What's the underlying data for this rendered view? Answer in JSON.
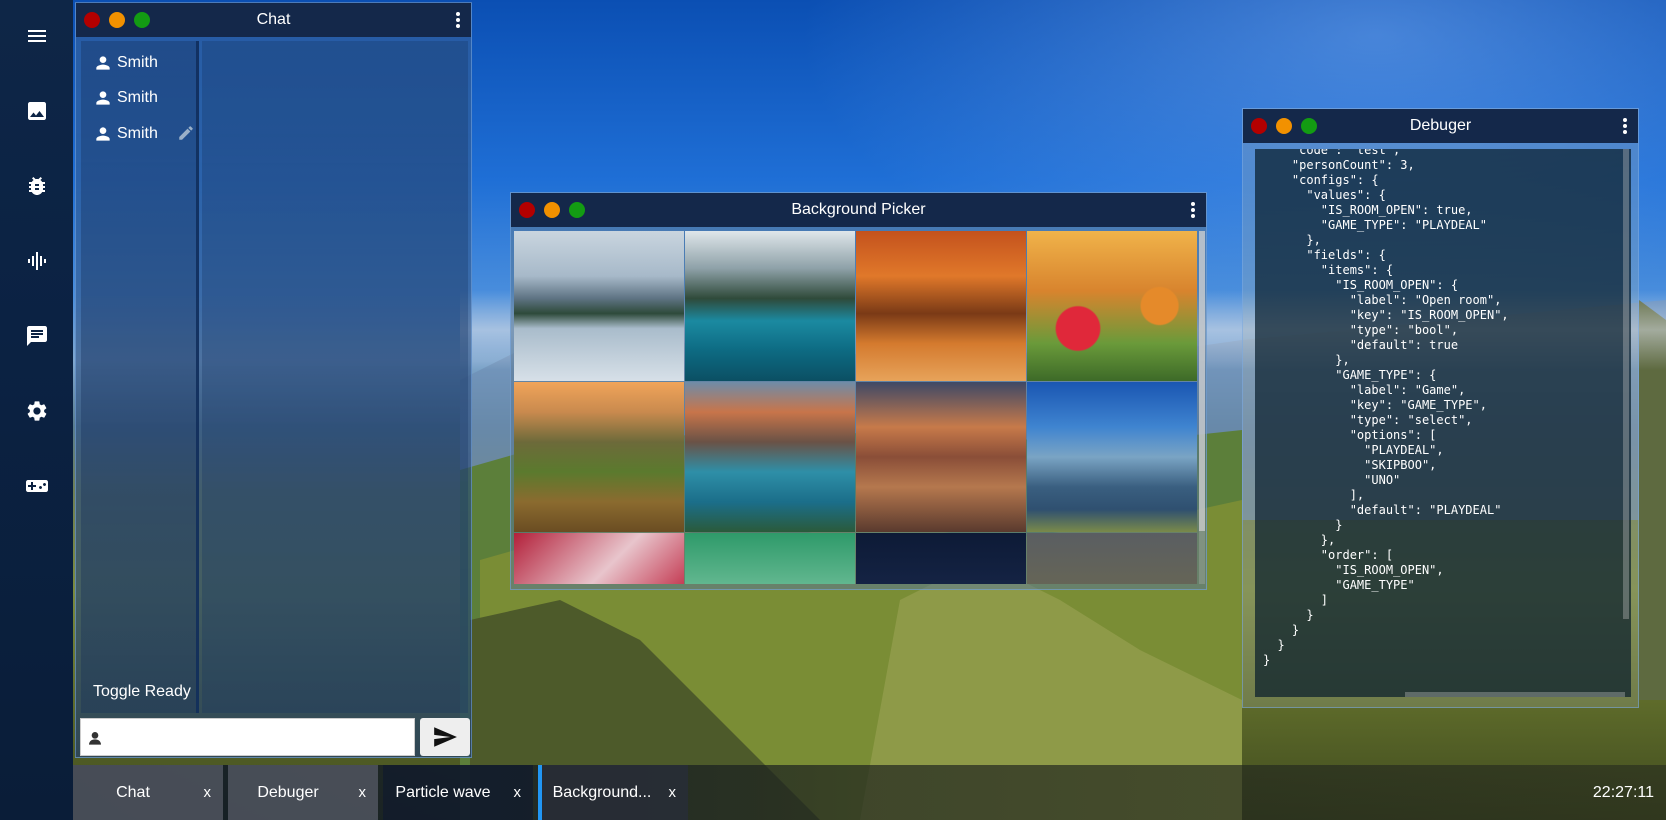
{
  "dock": {
    "items": [
      {
        "icon": "menu-icon"
      },
      {
        "icon": "image-icon"
      },
      {
        "icon": "bug-icon"
      },
      {
        "icon": "audio-wave-icon"
      },
      {
        "icon": "chat-icon"
      },
      {
        "icon": "gear-icon"
      },
      {
        "icon": "gamepad-icon"
      }
    ]
  },
  "chat_window": {
    "title": "Chat",
    "users": [
      {
        "name": "Smith"
      },
      {
        "name": "Smith"
      },
      {
        "name": "Smith"
      }
    ],
    "toggle_ready": "Toggle Ready",
    "input_value": "",
    "input_placeholder": ""
  },
  "picker_window": {
    "title": "Background Picker",
    "thumbnails": [
      {
        "subject": "alpine-lake-reflection"
      },
      {
        "subject": "teal-mountain-lake"
      },
      {
        "subject": "autumn-forest-path"
      },
      {
        "subject": "flower-and-butterfly"
      },
      {
        "subject": "rolling-hills-vineyard"
      },
      {
        "subject": "moraine-lake-peaks"
      },
      {
        "subject": "city-skyline-sunset"
      },
      {
        "subject": "mountain-valley-blue-sky"
      },
      {
        "subject": "pink-blossoms"
      },
      {
        "subject": "green-rain-drops"
      },
      {
        "subject": "starry-night"
      },
      {
        "subject": "blurred-desktop"
      }
    ]
  },
  "debugger_window": {
    "title": "Debuger",
    "code": "    \"code\": \"test\",\n    \"personCount\": 3,\n    \"configs\": {\n      \"values\": {\n        \"IS_ROOM_OPEN\": true,\n        \"GAME_TYPE\": \"PLAYDEAL\"\n      },\n      \"fields\": {\n        \"items\": {\n          \"IS_ROOM_OPEN\": {\n            \"label\": \"Open room\",\n            \"key\": \"IS_ROOM_OPEN\",\n            \"type\": \"bool\",\n            \"default\": true\n          },\n          \"GAME_TYPE\": {\n            \"label\": \"Game\",\n            \"key\": \"GAME_TYPE\",\n            \"type\": \"select\",\n            \"options\": [\n              \"PLAYDEAL\",\n              \"SKIPBOO\",\n              \"UNO\"\n            ],\n            \"default\": \"PLAYDEAL\"\n          }\n        },\n        \"order\": [\n          \"IS_ROOM_OPEN\",\n          \"GAME_TYPE\"\n        ]\n      }\n    }\n  }\n}"
  },
  "taskbar": {
    "tasks": [
      {
        "label": "Chat",
        "close": "x"
      },
      {
        "label": "Debuger",
        "close": "x"
      },
      {
        "label": "Particle wave",
        "close": "x"
      },
      {
        "label": "Background...",
        "close": "x"
      }
    ],
    "clock": "22:27:11"
  },
  "colors": {
    "titlebar": "#14284a",
    "close": "#b30000",
    "minimize": "#f29100",
    "maximize": "#139c13",
    "active_task_accent": "#2196f3"
  }
}
